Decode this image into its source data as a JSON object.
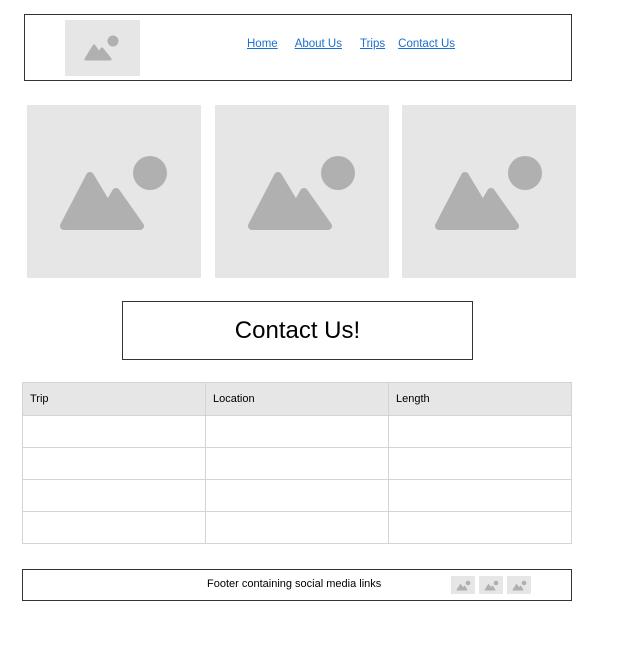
{
  "header": {
    "logo_icon": "image-placeholder-icon",
    "nav": [
      {
        "label": "Home"
      },
      {
        "label": "About Us"
      },
      {
        "label": "Trips"
      },
      {
        "label": "Contact Us"
      }
    ],
    "link_color": "#1a6fd1"
  },
  "gallery": {
    "images": [
      {
        "icon": "image-placeholder-icon"
      },
      {
        "icon": "image-placeholder-icon"
      },
      {
        "icon": "image-placeholder-icon"
      }
    ],
    "placeholder_bg": "#e6e6e6",
    "placeholder_fg": "#b0b0b0"
  },
  "contact": {
    "title": "Contact Us!"
  },
  "table": {
    "headers": [
      "Trip",
      "Location",
      "Length"
    ],
    "rows": [
      [
        "",
        "",
        ""
      ],
      [
        "",
        "",
        ""
      ],
      [
        "",
        "",
        ""
      ],
      [
        "",
        "",
        ""
      ]
    ]
  },
  "footer": {
    "text": "Footer containing social media links",
    "social_icons": [
      "image-placeholder-icon",
      "image-placeholder-icon",
      "image-placeholder-icon"
    ]
  }
}
